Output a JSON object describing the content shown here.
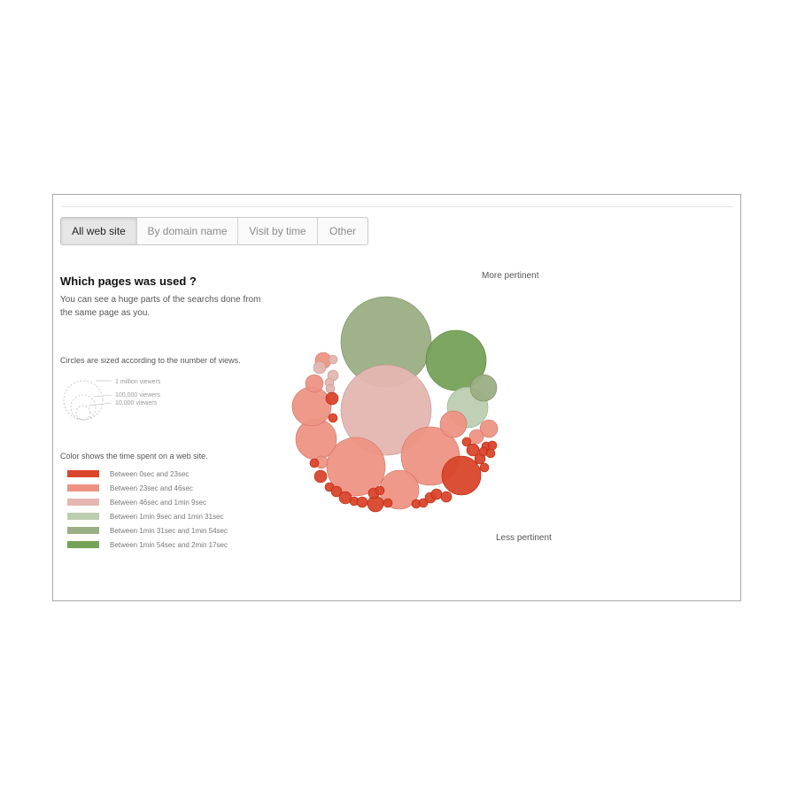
{
  "tabs": [
    {
      "label": "All web site",
      "active": true
    },
    {
      "label": "By domain name",
      "active": false
    },
    {
      "label": "Visit by time",
      "active": false
    },
    {
      "label": "Other",
      "active": false
    }
  ],
  "heading": "Which pages was used ?",
  "description": "You can see a huge parts of the searchs done from the same page as you.",
  "size_legend": {
    "title": "Circles are sized according to the number of views.",
    "labels": [
      "1 million viewers",
      "100,000 viewers",
      "10,000 viewers"
    ]
  },
  "color_legend": {
    "title": "Color shows the time spent on a web site.",
    "items": [
      {
        "label": "Between 0sec and 23sec",
        "color": "#d9462b"
      },
      {
        "label": "Between 23sec and 46sec",
        "color": "#ee9384"
      },
      {
        "label": "Between 46sec and 1min 9sec",
        "color": "#e4b6b0"
      },
      {
        "label": "Between 1min 9sec and 1min 31sec",
        "color": "#bccdb0"
      },
      {
        "label": "Between 1min 31sec and 1min 54sec",
        "color": "#9aae84"
      },
      {
        "label": "Between 1min 54sec and 2min 17sec",
        "color": "#76a257"
      }
    ]
  },
  "axis_labels": {
    "top": "More pertinent",
    "bottom": "Less pertinent"
  },
  "chart_data": {
    "type": "scatter",
    "description_kind": "bubble",
    "legend": [
      "Between 0sec and 23sec",
      "Between 23sec and 46sec",
      "Between 46sec and 1min 9sec",
      "Between 1min 9sec and 1min 31sec",
      "Between 1min 31sec and 1min 54sec",
      "Between 1min 54sec and 2min 17sec"
    ],
    "bubble_classes": [
      0,
      1,
      2,
      3,
      4,
      5
    ],
    "bubbles": [
      {
        "class": 4,
        "views": 1000000
      },
      {
        "class": 2,
        "views": 1000000
      },
      {
        "class": 5,
        "views": 450000
      },
      {
        "class": 1,
        "views": 430000
      },
      {
        "class": 1,
        "views": 430000
      },
      {
        "class": 1,
        "views": 190000
      },
      {
        "class": 1,
        "views": 190000
      },
      {
        "class": 3,
        "views": 190000
      },
      {
        "class": 1,
        "views": 170000
      },
      {
        "class": 0,
        "views": 190000
      },
      {
        "class": 4,
        "views": 80000
      },
      {
        "class": 1,
        "views": 80000
      },
      {
        "class": 1,
        "views": 40000
      },
      {
        "class": 1,
        "views": 35000
      },
      {
        "class": 1,
        "views": 35000
      },
      {
        "class": 2,
        "views": 30000
      },
      {
        "class": 2,
        "views": 20000
      },
      {
        "class": 2,
        "views": 15000
      },
      {
        "class": 2,
        "views": 10000
      },
      {
        "class": 2,
        "views": 8000
      },
      {
        "class": 1,
        "views": 10000
      },
      {
        "class": 1,
        "views": 7000
      },
      {
        "class": 0,
        "views": 15000
      },
      {
        "class": 0,
        "views": 8000
      },
      {
        "class": 0,
        "views": 8000
      },
      {
        "class": 0,
        "views": 12000
      },
      {
        "class": 0,
        "views": 15000
      },
      {
        "class": 0,
        "views": 10000
      },
      {
        "class": 0,
        "views": 8000
      },
      {
        "class": 0,
        "views": 10000
      },
      {
        "class": 0,
        "views": 8000
      },
      {
        "class": 0,
        "views": 15000
      },
      {
        "class": 0,
        "views": 12000
      },
      {
        "class": 0,
        "views": 25000
      },
      {
        "class": 0,
        "views": 12000
      },
      {
        "class": 0,
        "views": 6000
      },
      {
        "class": 0,
        "views": 6000
      },
      {
        "class": 0,
        "views": 12000
      },
      {
        "class": 0,
        "views": 6000
      },
      {
        "class": 0,
        "views": 12000
      },
      {
        "class": 0,
        "views": 8000
      },
      {
        "class": 0,
        "views": 8000
      },
      {
        "class": 0,
        "views": 6000
      },
      {
        "class": 0,
        "views": 6000
      },
      {
        "class": 0,
        "views": 10000
      },
      {
        "class": 0,
        "views": 8000
      },
      {
        "class": 0,
        "views": 6000
      },
      {
        "class": 0,
        "views": 6000
      }
    ]
  }
}
